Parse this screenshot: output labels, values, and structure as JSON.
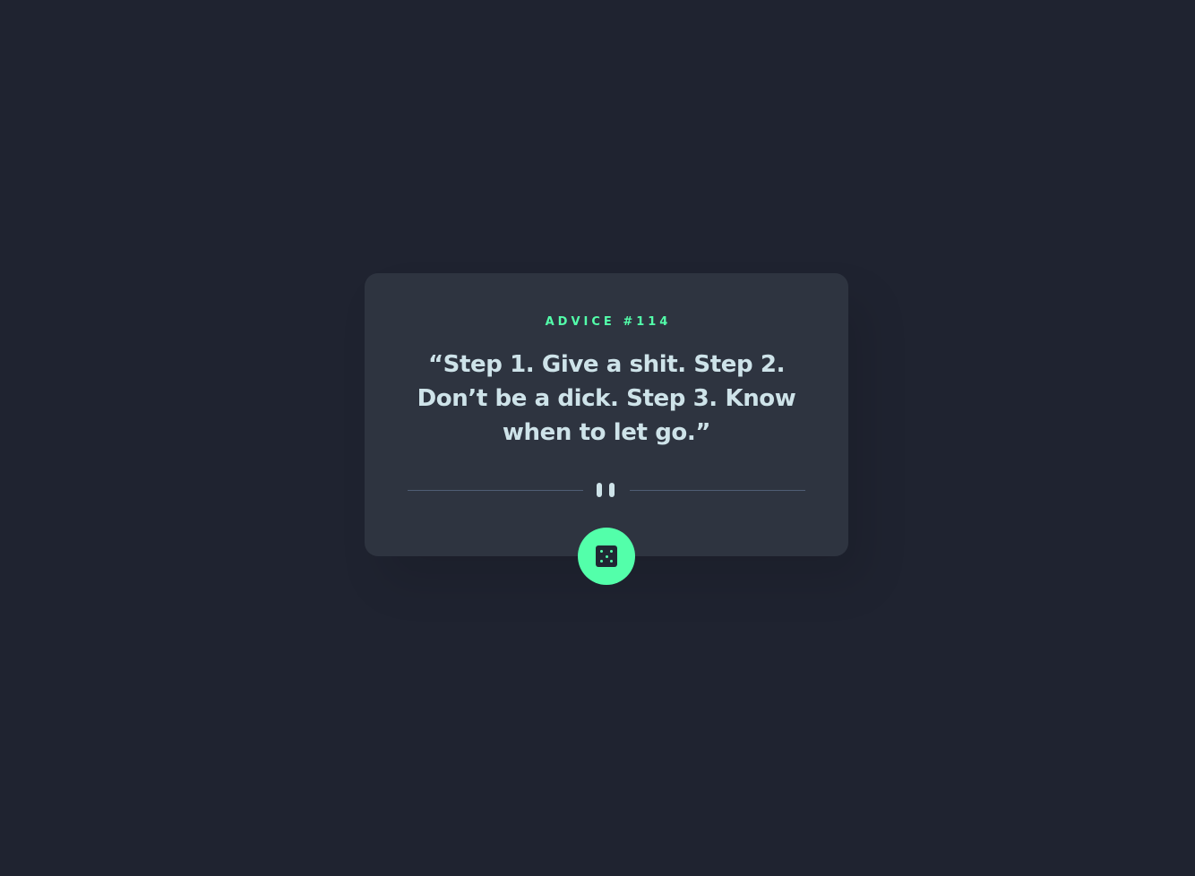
{
  "card": {
    "label": "ADVICE #114",
    "quote": "“Step 1. Give a shit. Step 2. Don’t be a dick. Step 3. Know when to let go.”"
  },
  "divider": {
    "icon": "pause-icon"
  },
  "dice_button": {
    "icon": "dice-icon"
  },
  "colors": {
    "background": "#1f2330",
    "card": "#2e3440",
    "accent": "#53ffaa",
    "text": "#cee3e9",
    "divider": "#4f5d74"
  }
}
